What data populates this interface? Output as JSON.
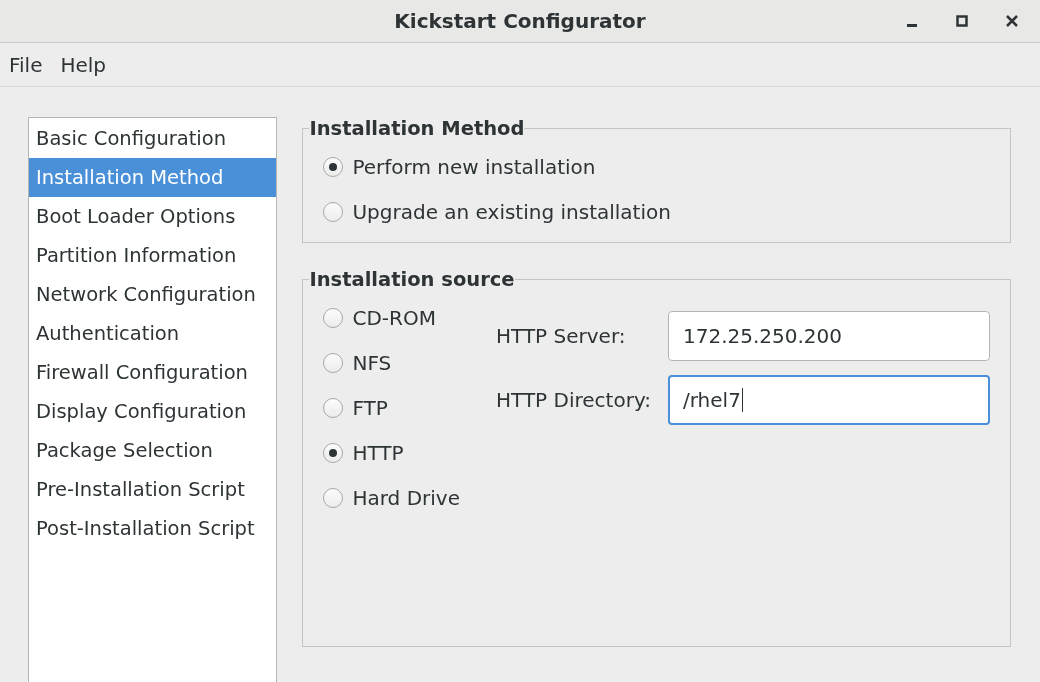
{
  "window": {
    "title": "Kickstart Configurator"
  },
  "menu": [
    "File",
    "Help"
  ],
  "sidebar": {
    "items": [
      {
        "label": "Basic Configuration",
        "selected": false
      },
      {
        "label": "Installation Method",
        "selected": true
      },
      {
        "label": "Boot Loader Options",
        "selected": false
      },
      {
        "label": "Partition Information",
        "selected": false
      },
      {
        "label": "Network Configuration",
        "selected": false
      },
      {
        "label": "Authentication",
        "selected": false
      },
      {
        "label": "Firewall Configuration",
        "selected": false
      },
      {
        "label": "Display Configuration",
        "selected": false
      },
      {
        "label": "Package Selection",
        "selected": false
      },
      {
        "label": "Pre-Installation Script",
        "selected": false
      },
      {
        "label": "Post-Installation Script",
        "selected": false
      }
    ]
  },
  "installation_method": {
    "title": "Installation Method",
    "options": [
      {
        "label": "Perform new installation",
        "selected": true
      },
      {
        "label": "Upgrade an existing installation",
        "selected": false
      }
    ]
  },
  "installation_source": {
    "title": "Installation source",
    "options": [
      {
        "label": "CD-ROM",
        "selected": false
      },
      {
        "label": "NFS",
        "selected": false
      },
      {
        "label": "FTP",
        "selected": false
      },
      {
        "label": "HTTP",
        "selected": true
      },
      {
        "label": "Hard Drive",
        "selected": false
      }
    ],
    "fields": [
      {
        "label": "HTTP Server:",
        "value": "172.25.250.200",
        "focused": false
      },
      {
        "label": "HTTP Directory:",
        "value": "/rhel7",
        "focused": true
      }
    ]
  }
}
